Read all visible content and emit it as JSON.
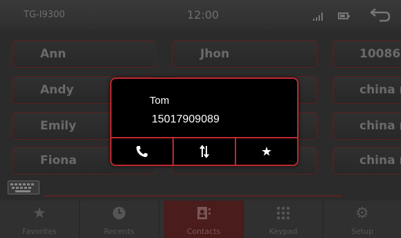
{
  "statusbar": {
    "device": "TG-I9300",
    "time": "12:00",
    "icons": [
      "signal-icon",
      "battery-icon",
      "back-icon"
    ]
  },
  "contacts": {
    "column1": [
      "Ann",
      "Andy",
      "Emily",
      "Fiona"
    ],
    "column2": [
      "Jhon",
      "",
      "",
      ""
    ],
    "column3": [
      "10086",
      "china m",
      "china m",
      "china m"
    ]
  },
  "popup": {
    "name": "Tom",
    "number": "15017909089",
    "actions": [
      "phone-icon",
      "transfer-icon",
      "star-icon"
    ]
  },
  "tabs": [
    {
      "label": "Favorites",
      "icon": "star-icon",
      "active": false
    },
    {
      "label": "Recents",
      "icon": "clock-icon",
      "active": false
    },
    {
      "label": "Contacts",
      "icon": "contacts-icon",
      "active": true
    },
    {
      "label": "Keypad",
      "icon": "keypad-icon",
      "active": false
    },
    {
      "label": "Setup",
      "icon": "gear-icon",
      "active": false
    }
  ],
  "colors": {
    "accent": "#c0282f",
    "popup_bg": "#000000",
    "background": "#2b2b2b"
  }
}
